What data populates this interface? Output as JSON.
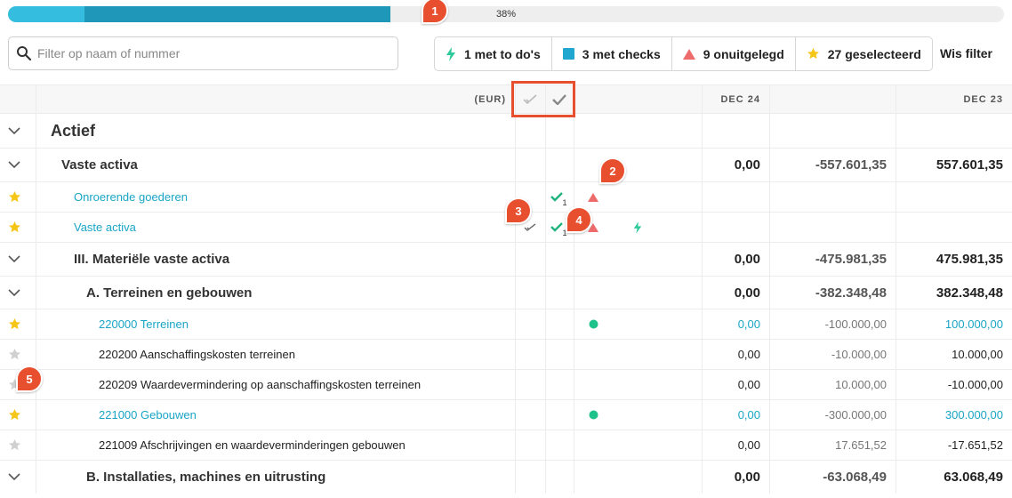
{
  "progress": {
    "percent": 38,
    "label": "38%"
  },
  "callouts": [
    "1",
    "2",
    "3",
    "4",
    "5"
  ],
  "search": {
    "placeholder": "Filter op naam of nummer",
    "value": ""
  },
  "filters": [
    {
      "label": "1 met to do's",
      "icon": "bolt-icon",
      "color": "#2ec99a"
    },
    {
      "label": "3 met checks",
      "icon": "square-icon",
      "color": "#1fa7cf"
    },
    {
      "label": "9 onuitgelegd",
      "icon": "triangle-icon",
      "color": "#ee6b6b"
    },
    {
      "label": "27 geselecteerd",
      "icon": "star-icon",
      "color": "#f5c518"
    }
  ],
  "clear_filter_label": "Wis filter",
  "columns": {
    "currency": "(EUR)",
    "period1": "DEC 24",
    "period2": "DEC 23"
  },
  "colors": {
    "accent": "#1aa5c7",
    "check": "#1fb37e",
    "warning": "#ee6b6b",
    "star": "#f5c518",
    "callout": "#e84f2e"
  },
  "rows": [
    {
      "type": "group",
      "label": "Actief",
      "v1": "",
      "v2": "",
      "v3": ""
    },
    {
      "type": "group",
      "label": "Vaste activa",
      "v1": "0,00",
      "v2": "-557.601,35",
      "v3": "557.601,35"
    },
    {
      "type": "account",
      "label": "Onroerende goederen",
      "v1": "",
      "v2": "",
      "v3": "",
      "check_count": "1"
    },
    {
      "type": "account",
      "label": "Vaste activa",
      "v1": "",
      "v2": "",
      "v3": "",
      "check_count": "1"
    },
    {
      "type": "group",
      "label": "III. Materiële vaste activa",
      "v1": "0,00",
      "v2": "-475.981,35",
      "v3": "475.981,35"
    },
    {
      "type": "group",
      "label": "A. Terreinen en gebouwen",
      "v1": "0,00",
      "v2": "-382.348,48",
      "v3": "382.348,48"
    },
    {
      "type": "account",
      "label": "220000 Terreinen",
      "v1": "0,00",
      "v2": "-100.000,00",
      "v3": "100.000,00"
    },
    {
      "type": "account",
      "label": "220200 Aanschaffingskosten terreinen",
      "v1": "0,00",
      "v2": "-10.000,00",
      "v3": "10.000,00"
    },
    {
      "type": "account",
      "label": "220209 Waardevermindering op aanschaffingskosten terreinen",
      "v1": "0,00",
      "v2": "10.000,00",
      "v3": "-10.000,00"
    },
    {
      "type": "account",
      "label": "221000 Gebouwen",
      "v1": "0,00",
      "v2": "-300.000,00",
      "v3": "300.000,00"
    },
    {
      "type": "account",
      "label": "221009 Afschrijvingen en waardeverminderingen gebouwen",
      "v1": "0,00",
      "v2": "17.651,52",
      "v3": "-17.651,52"
    },
    {
      "type": "group",
      "label": "B. Installaties, machines en uitrusting",
      "v1": "0,00",
      "v2": "-63.068,49",
      "v3": "63.068,49"
    }
  ]
}
